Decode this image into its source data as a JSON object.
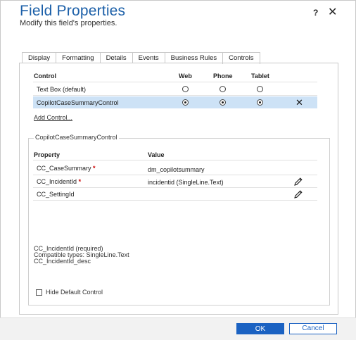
{
  "dialog": {
    "title": "Field Properties",
    "subtitle": "Modify this field's properties.",
    "help": "?",
    "close": "✕"
  },
  "tabs": [
    {
      "label": "Display"
    },
    {
      "label": "Formatting"
    },
    {
      "label": "Details"
    },
    {
      "label": "Events"
    },
    {
      "label": "Business Rules"
    },
    {
      "label": "Controls",
      "active": true
    }
  ],
  "controls_table": {
    "headers": {
      "control": "Control",
      "web": "Web",
      "phone": "Phone",
      "tablet": "Tablet"
    },
    "rows": [
      {
        "name": "Text Box (default)",
        "web": false,
        "phone": false,
        "tablet": false,
        "selected": false
      },
      {
        "name": "CopilotCaseSummaryControl",
        "web": true,
        "phone": true,
        "tablet": true,
        "selected": true
      }
    ],
    "remove_icon": "✕",
    "add_link": "Add Control..."
  },
  "properties_group": {
    "title": "CopilotCaseSummaryControl",
    "headers": {
      "property": "Property",
      "value": "Value"
    },
    "rows": [
      {
        "property": "CC_CaseSummary",
        "required_mark": "*",
        "value": "dm_copilotsummary",
        "editable": false
      },
      {
        "property": "CC_IncidentId",
        "required_mark": "*",
        "value": "incidentid (SingleLine.Text)",
        "editable": true
      },
      {
        "property": "CC_SettingId",
        "required_mark": "",
        "value": "",
        "editable": true
      }
    ],
    "description": {
      "line1": "CC_IncidentId (required)",
      "line2": "Compatible types: SingleLine.Text",
      "line3": "CC_IncidentId_desc"
    },
    "hide_default_label": "Hide Default Control",
    "hide_default_checked": false
  },
  "footer": {
    "ok_label": "OK",
    "cancel_label": "Cancel"
  },
  "colors": {
    "accent": "#1b62c2",
    "title": "#1b5fa8",
    "selected_row": "#cde2f6",
    "required": "#cc0000"
  }
}
